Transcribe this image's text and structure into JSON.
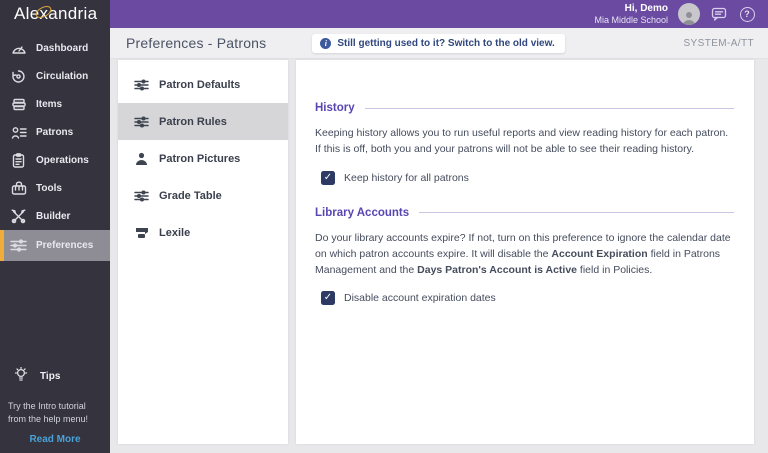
{
  "brand": {
    "name_pre": "Ale",
    "name_x": "x",
    "name_post": "andria"
  },
  "topbar": {
    "greeting": "Hi, Demo",
    "school": "Mia Middle School",
    "help_glyph": "?"
  },
  "sidebar": {
    "items": [
      {
        "label": "Dashboard",
        "icon": "dashboard"
      },
      {
        "label": "Circulation",
        "icon": "circulation"
      },
      {
        "label": "Items",
        "icon": "items"
      },
      {
        "label": "Patrons",
        "icon": "patrons"
      },
      {
        "label": "Operations",
        "icon": "operations"
      },
      {
        "label": "Tools",
        "icon": "tools"
      },
      {
        "label": "Builder",
        "icon": "builder"
      },
      {
        "label": "Preferences",
        "icon": "preferences",
        "selected": true
      }
    ],
    "tips": {
      "title": "Tips",
      "body": "Try the Intro tutorial from the help menu!",
      "link": "Read More"
    }
  },
  "header": {
    "title": "Preferences - Patrons",
    "notice": "Still getting used to it? Switch to the old view.",
    "notice_icon_glyph": "i",
    "system_label": "SYSTEM-A/TT"
  },
  "subnav": {
    "items": [
      {
        "label": "Patron Defaults",
        "icon": "sliders"
      },
      {
        "label": "Patron Rules",
        "icon": "sliders",
        "selected": true
      },
      {
        "label": "Patron Pictures",
        "icon": "person"
      },
      {
        "label": "Grade Table",
        "icon": "sliders"
      },
      {
        "label": "Lexile",
        "icon": "lexile"
      }
    ]
  },
  "main": {
    "sections": [
      {
        "title": "History",
        "body": "Keeping history allows you to run useful reports and view reading history for each patron. If this is off, both you and your patrons will not be able to see their reading history.",
        "checkbox": {
          "label": "Keep history for all patrons",
          "checked": true,
          "glyph": "✓"
        }
      },
      {
        "title": "Library Accounts",
        "body_parts": {
          "p1": "Do your library accounts expire? If not, turn on this preference to ignore the calendar date on which patron accounts expire. It will disable the ",
          "b1": "Account Expiration",
          "p2": " field in Patrons Management and the ",
          "b2": "Days Patron's Account is Active",
          "p3": " field in Policies."
        },
        "checkbox": {
          "label": "Disable account expiration dates",
          "checked": true,
          "glyph": "✓"
        }
      }
    ]
  },
  "colors": {
    "topbar_purple": "#6b4ba1",
    "sidebar_dark": "#34333e",
    "selected_accent": "#f0ad3a",
    "section_purple": "#5946b2",
    "checkbox_navy": "#2d3a64",
    "readmore_blue": "#4aa2d8"
  }
}
